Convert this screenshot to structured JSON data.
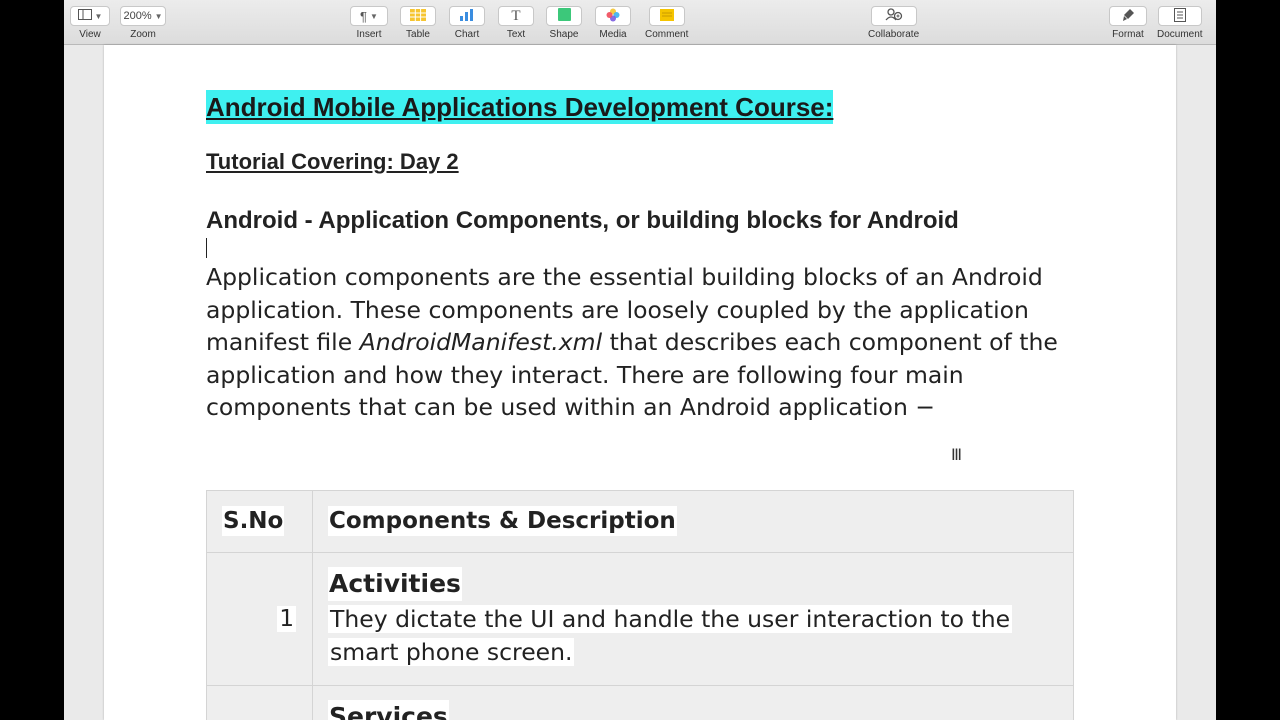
{
  "toolbar": {
    "view": "View",
    "zoom_value": "200%",
    "zoom": "Zoom",
    "insert": "Insert",
    "table": "Table",
    "chart": "Chart",
    "text": "Text",
    "shape": "Shape",
    "media": "Media",
    "comment": "Comment",
    "collaborate": "Collaborate",
    "format": "Format",
    "document": "Document"
  },
  "document": {
    "title": "Android Mobile Applications Development Course:",
    "subtitle": "Tutorial Covering: Day 2",
    "heading": "Android - Application Components, or building blocks for Android",
    "para_part1": "Application components are the essential building blocks of an Android application. These components are loosely coupled by the application manifest file ",
    "para_italic": "AndroidManifest.xml",
    "para_part2": " that describes each component of the application and how they interact. There are following four main components that can be used within an Android application −"
  },
  "table": {
    "headers": [
      "S.No",
      "Components & Description"
    ],
    "rows": [
      {
        "num": "1",
        "title": "Activities",
        "desc": "They dictate the UI and handle the user interaction to the smart phone screen."
      },
      {
        "num": "",
        "title": "Services",
        "desc": ""
      }
    ]
  },
  "colors": {
    "title_highlight": "#3ff0f0",
    "table_cell_bg": "#eeeeee"
  }
}
